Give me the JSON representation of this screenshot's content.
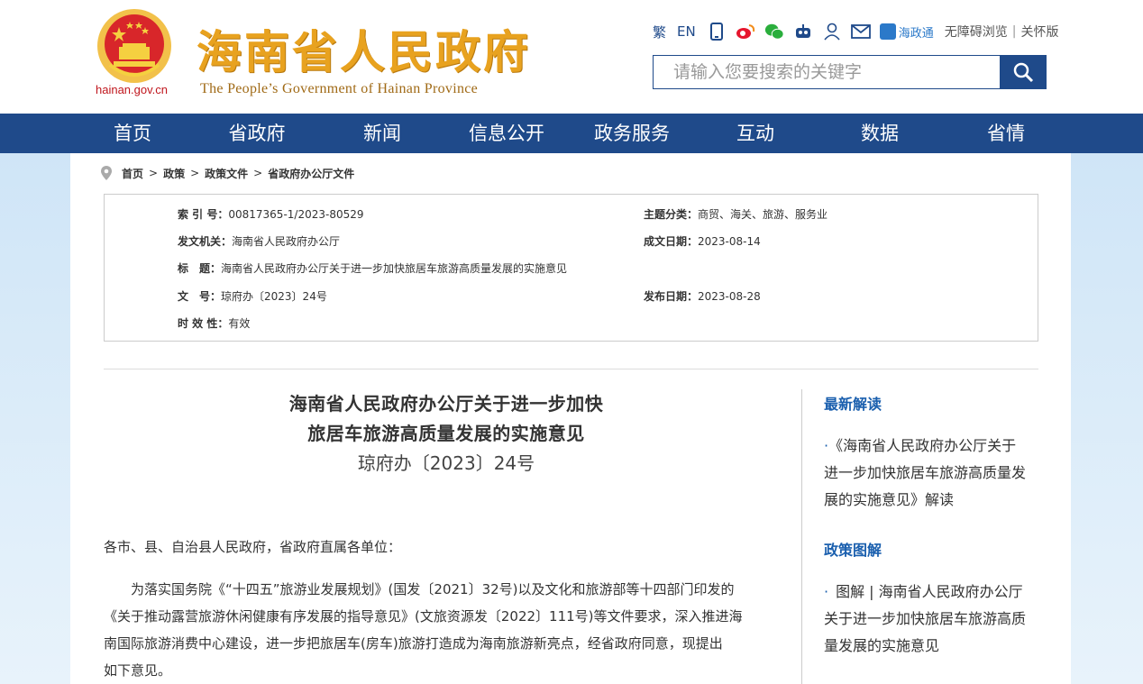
{
  "header": {
    "domain": "hainan.gov.cn",
    "title_cn": "海南省人民政府",
    "title_en": "The People’s Government  of Hainan Province",
    "toolbar": {
      "traditional": "繁",
      "english": "EN",
      "haizhengtong": "海政通",
      "accessibility": "无障碍浏览",
      "separator": "|",
      "care_mode": "关怀版"
    },
    "search": {
      "placeholder": "请输入您要搜索的关键字"
    }
  },
  "nav": [
    "首页",
    "省政府",
    "新闻",
    "信息公开",
    "政务服务",
    "互动",
    "数据",
    "省情"
  ],
  "breadcrumb": [
    "首页",
    "政策",
    "政策文件",
    "省政府办公厅文件"
  ],
  "breadcrumb_sep": ">",
  "meta": {
    "index_label": "索 引 号：",
    "index_value": "00817365-1/2023-80529",
    "topic_label": "主题分类：",
    "topic_value": "商贸、海关、旅游、服务业",
    "issuer_label": "发文机关：",
    "issuer_value": "海南省人民政府办公厅",
    "date_label": "成文日期：",
    "date_value": "2023-08-14",
    "title_label": "标　题：",
    "title_value": "海南省人民政府办公厅关于进一步加快旅居车旅游高质量发展的实施意见",
    "docno_label": "文　号：",
    "docno_value": "琼府办〔2023〕24号",
    "pubdate_label": "发布日期：",
    "pubdate_value": "2023-08-28",
    "validity_label": "时 效 性：",
    "validity_value": "有效"
  },
  "article": {
    "title_line1": "海南省人民政府办公厅关于进一步加快",
    "title_line2": "旅居车旅游高质量发展的实施意见",
    "doc_number": "琼府办〔2023〕24号",
    "greeting": "各市、县、自治县人民政府，省政府直属各单位：",
    "para1_l1": "　　为落实国务院《“十四五”旅游业发展规划》(国发〔2021〕32号)以及文化和旅游部等十四部门印发的",
    "para1_l2": "《关于推动露营旅游休闲健康有序发展的指导意见》(文旅资源发〔2022〕111号)等文件要求，深入推进海",
    "para1_l3": "南国际旅游消费中心建设，进一步把旅居车(房车)旅游打造成为海南旅游新亮点，经省政府同意，现提出",
    "para1_l4": "如下意见。"
  },
  "sidebar": {
    "latest_heading": "最新解读",
    "latest_item_l1": "《海南省人民政府办公厅关于",
    "latest_item_l2": "进一步加快旅居车旅游高质量发",
    "latest_item_l3": "展的实施意见》解读",
    "graphic_heading": "政策图解",
    "graphic_item_l1": "图解 | 海南省人民政府办公厅",
    "graphic_item_l2": "关于进一步加快旅居车旅游高质",
    "graphic_item_l3": "量发展的实施意见",
    "bullet": "·"
  },
  "colors": {
    "nav_bg": "#1f4a8a",
    "title_gold": "#e8a21f",
    "link_blue": "#1a5fae"
  }
}
